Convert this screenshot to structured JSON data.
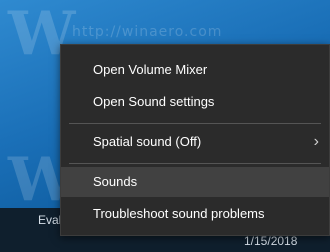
{
  "context_menu": {
    "items": [
      {
        "label": "Open Volume Mixer"
      },
      {
        "label": "Open Sound settings"
      },
      {
        "label": "Spatial sound (Off)",
        "submenu": true
      },
      {
        "label": "Sounds",
        "highlighted": true
      },
      {
        "label": "Troubleshoot sound problems"
      }
    ]
  },
  "taskbar": {
    "eval_text": "Eval",
    "date": "1/15/2018"
  },
  "watermark": {
    "logo_glyph": "W",
    "url": "http://winaero.com"
  },
  "colors": {
    "menu_background": "#2b2b2b",
    "menu_highlight": "#414141",
    "taskbar": "#0f1f2d",
    "desktop": "#1a6fb7"
  },
  "icons": {
    "submenu_arrow": "chevron-right-icon"
  }
}
